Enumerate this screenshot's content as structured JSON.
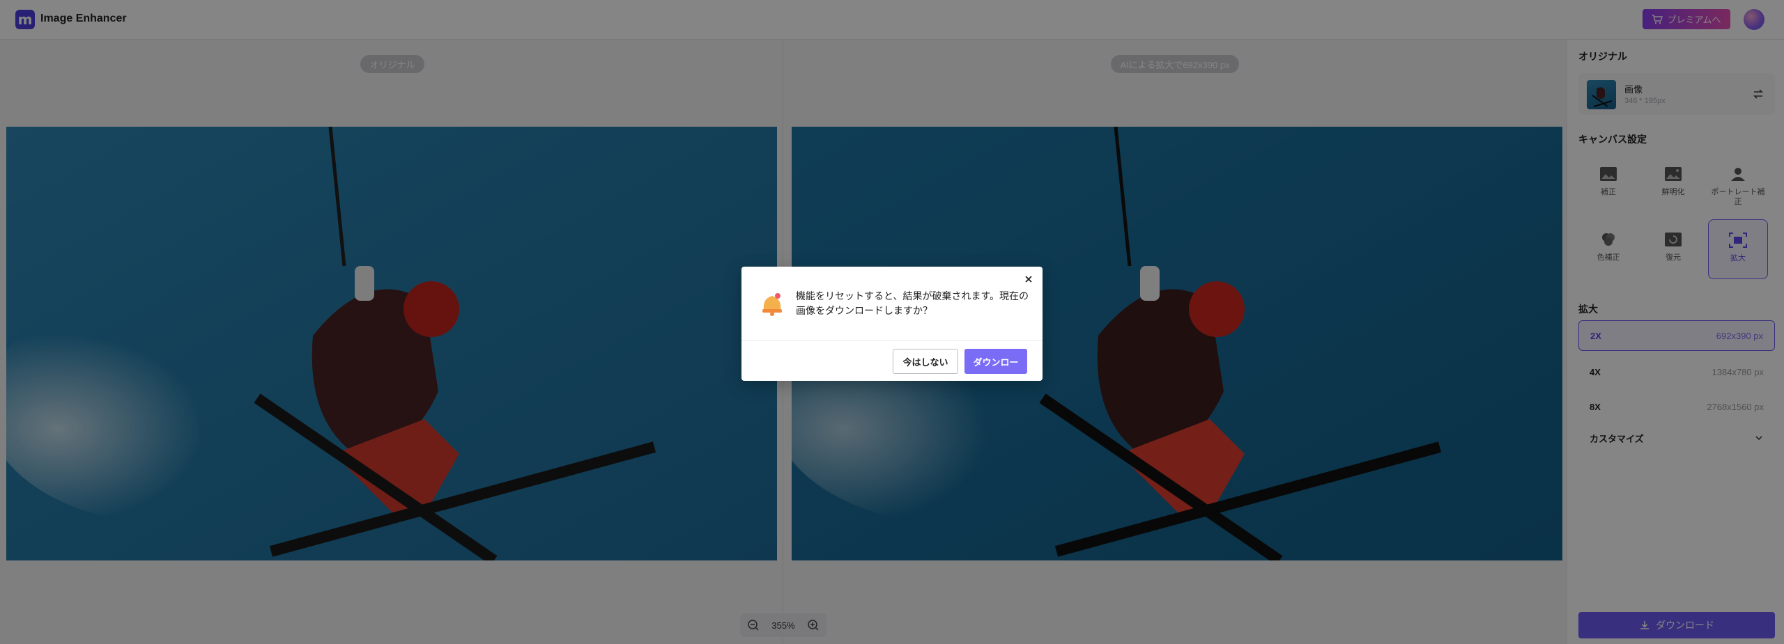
{
  "header": {
    "app_title": "Image Enhancer",
    "logo_letter": "m",
    "premium_label": "プレミアムへ"
  },
  "compare": {
    "original_label": "オリジナル",
    "ai_label": "AIによる拡大で692x390 px",
    "zoom_value": "355%"
  },
  "panel": {
    "original_heading": "オリジナル",
    "original_file": {
      "name": "画像",
      "size": "346 * 195px"
    },
    "canvas_heading": "キャンバス設定",
    "tools": [
      {
        "label": "補正",
        "icon": "image-icon"
      },
      {
        "label": "鮮明化",
        "icon": "image-sharpen-icon"
      },
      {
        "label": "ポートレート補正",
        "icon": "portrait-icon"
      },
      {
        "label": "色補正",
        "icon": "color-icon"
      },
      {
        "label": "復元",
        "icon": "restore-icon"
      },
      {
        "label": "拡大",
        "icon": "upscale-icon",
        "active": true
      }
    ],
    "scale_heading": "拡大",
    "scales": [
      {
        "name": "2X",
        "value": "692x390 px",
        "active": true
      },
      {
        "name": "4X",
        "value": "1384x780 px"
      },
      {
        "name": "8X",
        "value": "2768x1560 px"
      }
    ],
    "customize_label": "カスタマイズ",
    "download_label": "ダウンロード"
  },
  "dialog": {
    "message": "機能をリセットすると、結果が破棄されます。現在の画像をダウンロードしますか？",
    "later_label": "今はしない",
    "download_label": "ダウンロー"
  },
  "colors": {
    "accent": "#6c5cf4",
    "premium_gradient_start": "#8b3ff0",
    "premium_gradient_end": "#e94fb3"
  }
}
